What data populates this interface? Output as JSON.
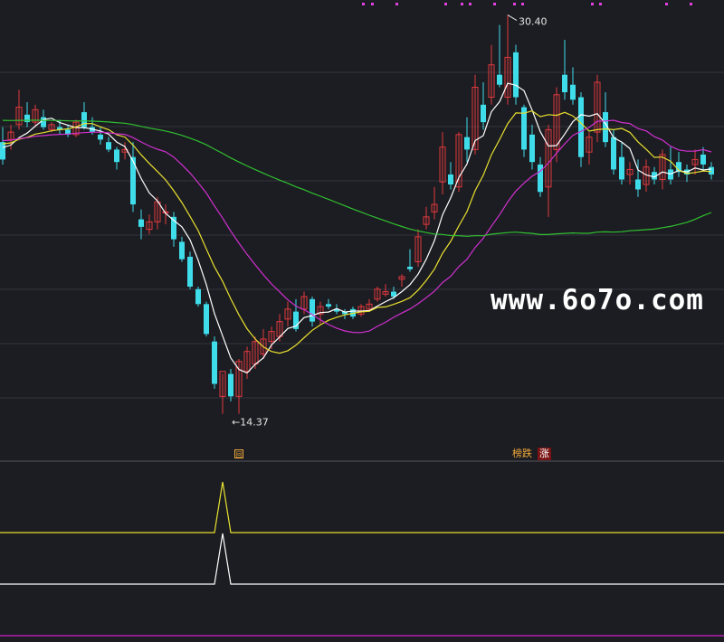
{
  "chart_data": {
    "type": "candlestick",
    "price_axis": {
      "min": 12.5,
      "max": 31.0
    },
    "annotations": {
      "high_label": "30.40",
      "low_label": "14.37"
    },
    "badges": {
      "left": "榜跌",
      "right": "涨"
    },
    "marker_box": "回",
    "candles": [
      [
        25.3,
        25.9,
        24.4,
        24.6
      ],
      [
        25.4,
        26.0,
        25.0,
        25.7
      ],
      [
        26.0,
        27.4,
        25.8,
        26.7
      ],
      [
        26.4,
        26.9,
        25.9,
        26.1
      ],
      [
        26.1,
        26.8,
        25.9,
        26.6
      ],
      [
        26.3,
        26.6,
        25.8,
        25.9
      ],
      [
        25.8,
        26.1,
        25.7,
        26.0
      ],
      [
        25.9,
        26.2,
        25.6,
        25.8
      ],
      [
        25.8,
        26.0,
        25.5,
        25.6
      ],
      [
        25.6,
        26.2,
        25.5,
        26.1
      ],
      [
        26.5,
        26.9,
        25.8,
        25.9
      ],
      [
        25.9,
        26.3,
        25.6,
        25.7
      ],
      [
        25.6,
        25.9,
        25.2,
        25.4
      ],
      [
        25.3,
        25.5,
        24.9,
        25.0
      ],
      [
        25.0,
        25.1,
        24.2,
        24.5
      ],
      [
        24.9,
        25.3,
        24.6,
        25.0
      ],
      [
        24.7,
        25.3,
        22.5,
        22.8
      ],
      [
        22.2,
        22.6,
        21.4,
        21.9
      ],
      [
        21.8,
        22.4,
        21.6,
        22.1
      ],
      [
        22.1,
        23.1,
        21.8,
        22.9
      ],
      [
        22.5,
        22.8,
        22.0,
        22.5
      ],
      [
        22.3,
        22.5,
        21.1,
        21.4
      ],
      [
        21.3,
        21.5,
        20.5,
        20.6
      ],
      [
        20.7,
        20.9,
        19.4,
        19.5
      ],
      [
        19.4,
        19.5,
        18.7,
        18.8
      ],
      [
        18.8,
        18.9,
        17.5,
        17.6
      ],
      [
        17.3,
        17.5,
        15.4,
        15.6
      ],
      [
        15.1,
        16.0,
        14.4,
        16.1
      ],
      [
        16.0,
        16.2,
        14.9,
        15.1
      ],
      [
        15.1,
        16.6,
        14.4,
        16.5
      ],
      [
        16.1,
        17.1,
        15.8,
        16.9
      ],
      [
        16.4,
        17.5,
        16.2,
        17.3
      ],
      [
        16.8,
        17.8,
        16.6,
        17.4
      ],
      [
        17.3,
        17.9,
        17.0,
        17.7
      ],
      [
        17.5,
        18.4,
        17.3,
        18.1
      ],
      [
        18.2,
        18.9,
        17.9,
        18.6
      ],
      [
        18.5,
        19.0,
        17.7,
        17.8
      ],
      [
        18.6,
        19.3,
        18.4,
        19.1
      ],
      [
        19.0,
        19.1,
        17.9,
        18.1
      ],
      [
        18.4,
        18.9,
        18.0,
        18.7
      ],
      [
        18.8,
        19.0,
        18.6,
        18.7
      ],
      [
        18.6,
        18.8,
        18.4,
        18.5
      ],
      [
        18.5,
        18.6,
        18.2,
        18.4
      ],
      [
        18.6,
        18.7,
        18.2,
        18.3
      ],
      [
        18.4,
        18.8,
        18.3,
        18.7
      ],
      [
        18.6,
        19.0,
        18.5,
        18.8
      ],
      [
        19.0,
        19.5,
        18.9,
        19.4
      ],
      [
        19.2,
        19.6,
        19.1,
        19.3
      ],
      [
        19.3,
        19.5,
        19.0,
        19.1
      ],
      [
        19.8,
        20.0,
        19.5,
        19.9
      ],
      [
        20.3,
        21.0,
        20.1,
        20.2
      ],
      [
        20.5,
        21.8,
        20.3,
        21.5
      ],
      [
        22.0,
        22.7,
        21.8,
        22.3
      ],
      [
        22.5,
        23.5,
        22.2,
        22.8
      ],
      [
        23.7,
        25.7,
        23.2,
        25.1
      ],
      [
        24.0,
        24.5,
        23.4,
        23.6
      ],
      [
        23.5,
        25.7,
        23.3,
        25.6
      ],
      [
        25.5,
        26.3,
        24.5,
        25.0
      ],
      [
        25.0,
        28.0,
        24.8,
        27.5
      ],
      [
        26.8,
        27.7,
        25.8,
        26.1
      ],
      [
        27.1,
        29.2,
        26.8,
        28.4
      ],
      [
        28.0,
        30.0,
        27.5,
        27.6
      ],
      [
        27.1,
        30.4,
        26.8,
        28.7
      ],
      [
        28.9,
        29.2,
        26.8,
        27.1
      ],
      [
        26.7,
        26.8,
        24.7,
        25.0
      ],
      [
        25.6,
        26.0,
        24.2,
        24.5
      ],
      [
        24.4,
        24.7,
        23.1,
        23.3
      ],
      [
        23.5,
        26.0,
        22.3,
        25.8
      ],
      [
        25.0,
        27.5,
        24.5,
        27.2
      ],
      [
        28.0,
        29.4,
        27.0,
        27.3
      ],
      [
        27.6,
        28.3,
        26.8,
        27.0
      ],
      [
        27.1,
        27.3,
        24.3,
        24.7
      ],
      [
        24.9,
        25.7,
        24.4,
        25.5
      ],
      [
        25.7,
        28.0,
        25.3,
        27.7
      ],
      [
        26.5,
        27.3,
        25.1,
        25.3
      ],
      [
        25.5,
        25.8,
        24.0,
        24.2
      ],
      [
        24.7,
        25.3,
        23.6,
        23.8
      ],
      [
        24.0,
        24.5,
        23.6,
        24.2
      ],
      [
        23.8,
        24.6,
        23.1,
        23.4
      ],
      [
        23.6,
        24.6,
        23.3,
        24.3
      ],
      [
        24.1,
        24.3,
        23.6,
        23.8
      ],
      [
        23.8,
        25.0,
        23.4,
        24.8
      ],
      [
        24.2,
        25.1,
        23.6,
        23.8
      ],
      [
        24.5,
        24.9,
        23.9,
        24.1
      ],
      [
        24.2,
        24.4,
        23.7,
        24.0
      ],
      [
        24.4,
        25.0,
        24.0,
        24.6
      ],
      [
        24.8,
        25.1,
        24.2,
        24.4
      ],
      [
        24.3,
        24.5,
        23.8,
        24.0
      ]
    ]
  }
}
